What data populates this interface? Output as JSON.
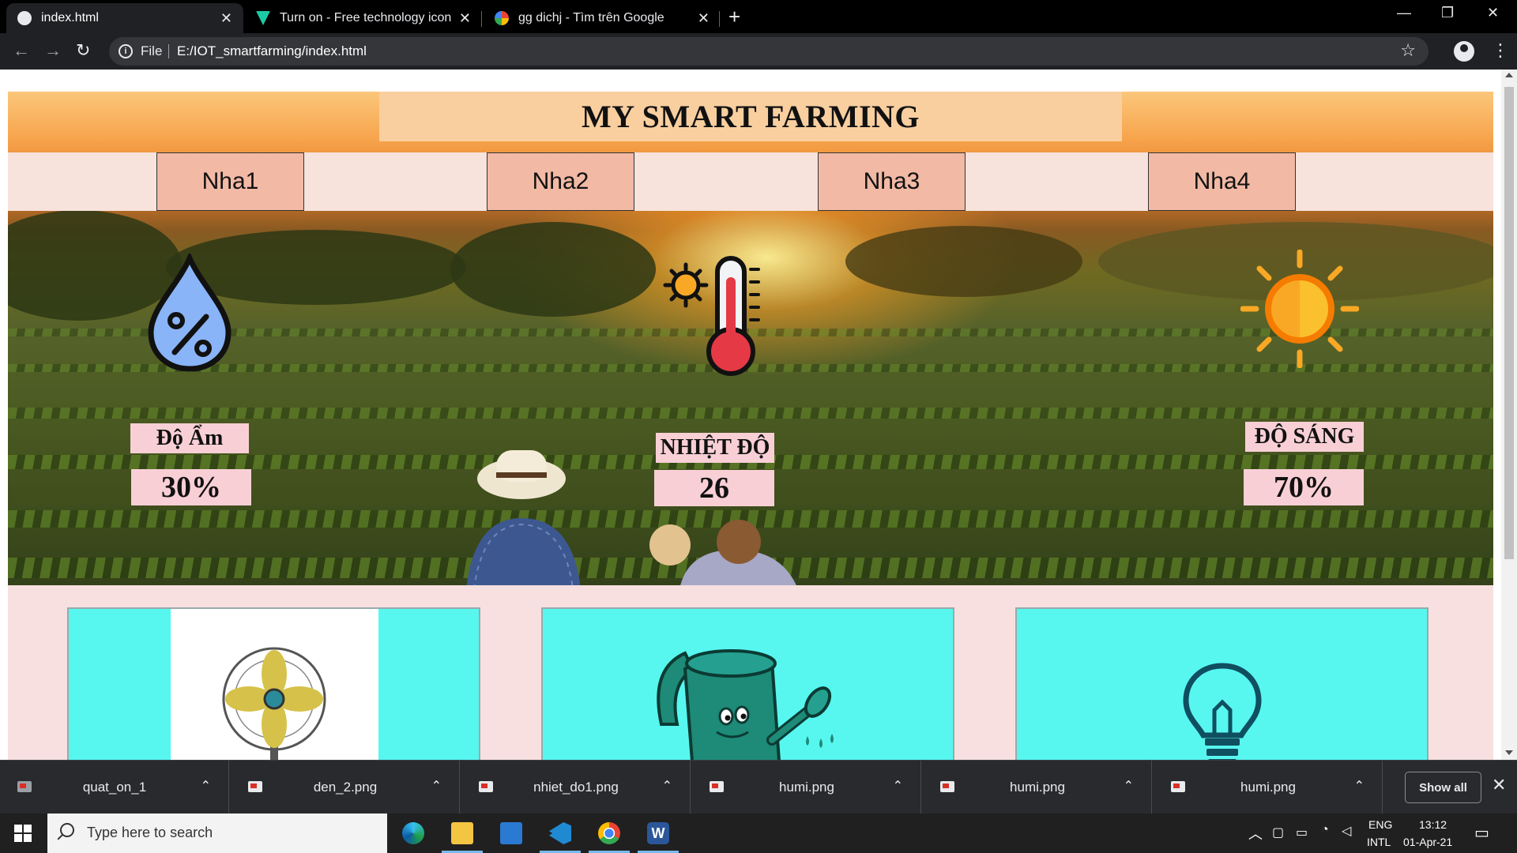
{
  "browser": {
    "tabs": [
      {
        "title": "index.html",
        "active": true
      },
      {
        "title": "Turn on - Free technology icons",
        "active": false
      },
      {
        "title": "gg dichj - Tìm trên Google",
        "active": false
      }
    ],
    "address": {
      "scheme": "File",
      "url": "E:/IOT_smartfarming/index.html"
    }
  },
  "page": {
    "title": "MY SMART FARMING",
    "nav": [
      "Nha1",
      "Nha2",
      "Nha3",
      "Nha4"
    ],
    "sensors": [
      {
        "icon": "humidity-drop-icon",
        "label": "Độ Ẩm",
        "value": "30%"
      },
      {
        "icon": "thermometer-icon",
        "label": "NHIỆT ĐỘ",
        "value": "26"
      },
      {
        "icon": "sun-brightness-icon",
        "label": "ĐỘ SÁNG",
        "value": "70%"
      }
    ],
    "controls": [
      {
        "icon": "fan-icon",
        "name": "fan"
      },
      {
        "icon": "watering-can-icon",
        "name": "watering-can"
      },
      {
        "icon": "light-bulb-icon",
        "name": "light-bulb"
      }
    ]
  },
  "downloads": {
    "items": [
      "quat_on_1",
      "den_2.png",
      "nhiet_do1.png",
      "humi.png",
      "humi.png",
      "humi.png"
    ],
    "show_all": "Show all"
  },
  "taskbar": {
    "search_placeholder": "Type here to search",
    "lang_top": "ENG",
    "lang_bottom": "INTL",
    "time": "13:12",
    "date": "01-Apr-21"
  },
  "colors": {
    "title_bg": "#f9cfa0",
    "nav_bg": "#f7e3dc",
    "nav_tab": "#f2b9a5",
    "sensor_label_bg": "#f9cfd6",
    "control_card": "#57f7f0",
    "controls_bg": "#f8e0e0"
  }
}
